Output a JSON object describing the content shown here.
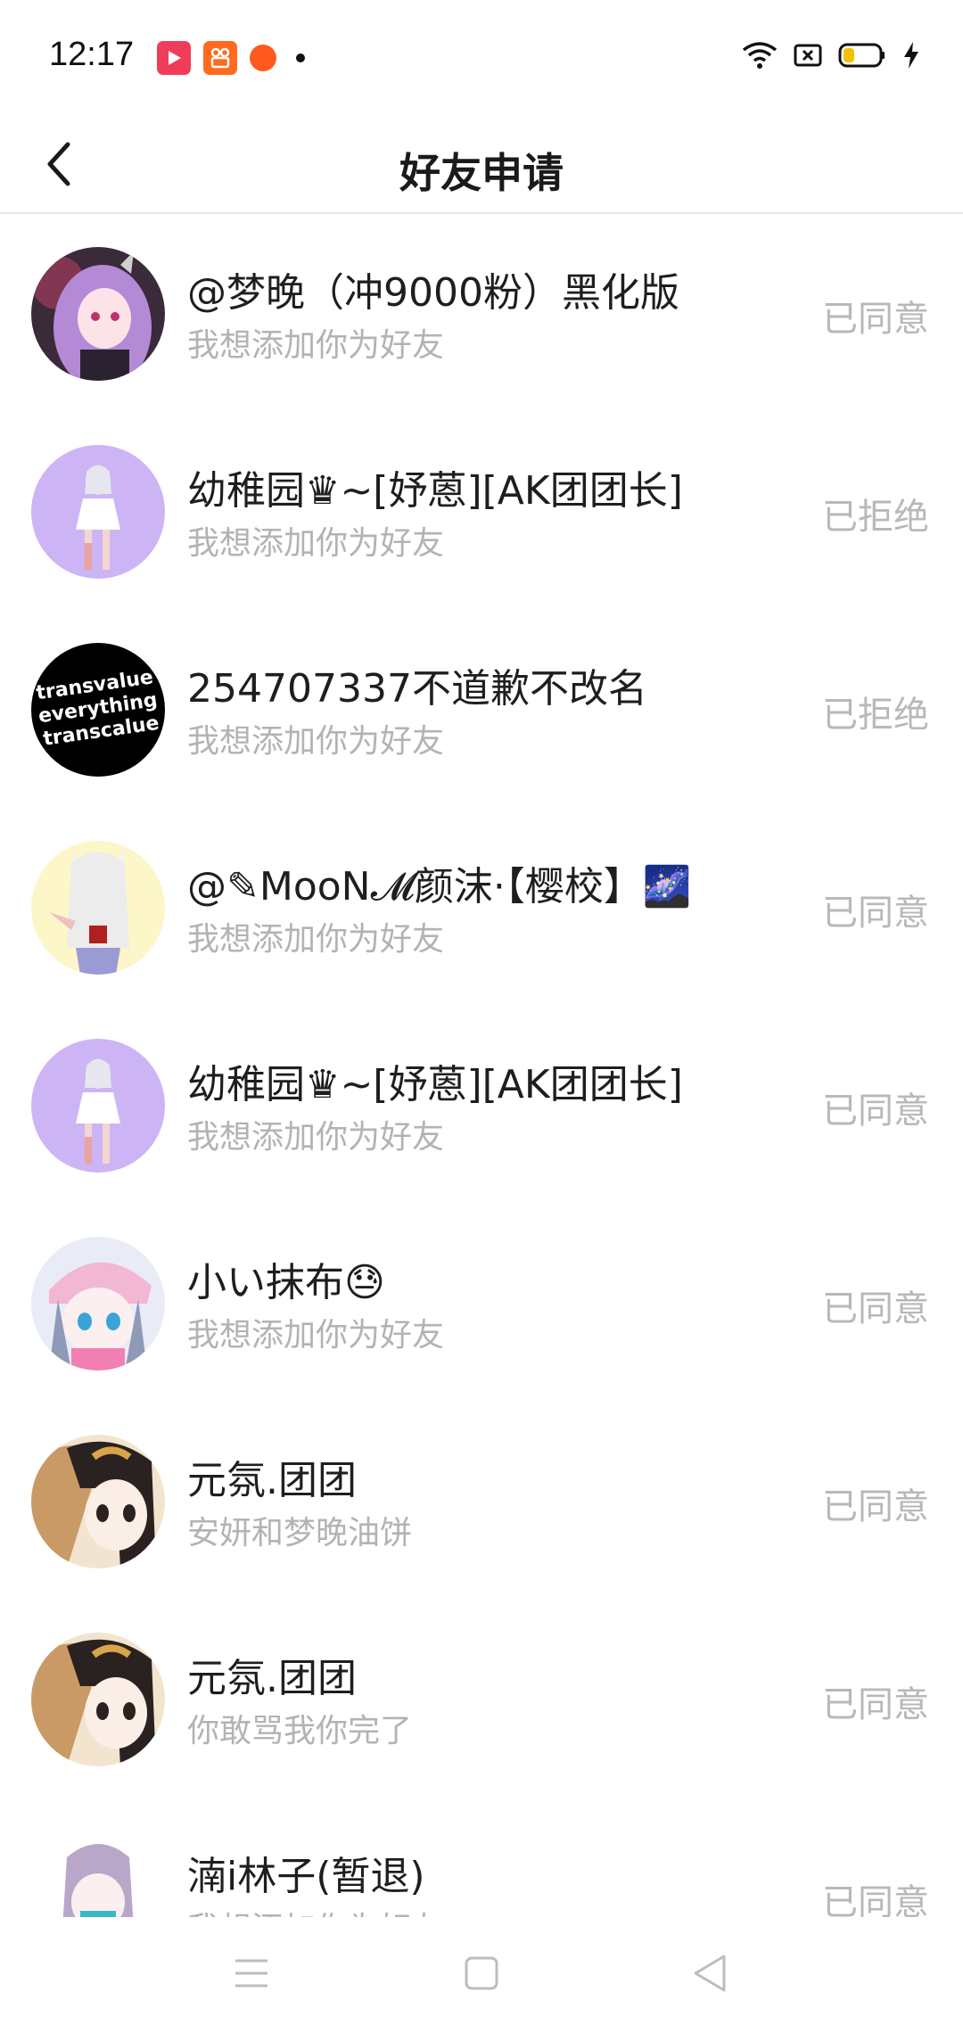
{
  "status_bar": {
    "time": "12:17",
    "apps": [
      "video-app-icon",
      "kuaishou-icon",
      "weibo-icon"
    ],
    "right_icons": [
      "wifi-icon",
      "no-sim-icon",
      "battery-icon",
      "charging-icon"
    ]
  },
  "header": {
    "title": "好友申请",
    "back_icon": "chevron-left-icon"
  },
  "requests": [
    {
      "name": "@梦晚（冲9000粉）黑化版",
      "message": "我想添加你为好友",
      "status": "已同意",
      "avatar": "anime-girl-purple-hair"
    },
    {
      "name": "幼稚园♛~[妤蒽][AK团团长]",
      "message": "我想添加你为好友",
      "status": "已拒绝",
      "avatar": "anime-girl-lavender"
    },
    {
      "name": "254707337不道歉不改名",
      "message": "我想添加你为好友",
      "status": "已拒绝",
      "avatar": "text-logo-black",
      "avatar_text": [
        "transvalue",
        "everything",
        "transcalue"
      ]
    },
    {
      "name": "@✎MooN𝓜颜沫·【樱校】🌌",
      "message": "我想添加你为好友",
      "status": "已同意",
      "avatar": "anime-cat-girl-yellow"
    },
    {
      "name": "幼稚园♛~[妤蒽][AK团团长]",
      "message": "我想添加你为好友",
      "status": "已同意",
      "avatar": "anime-girl-lavender"
    },
    {
      "name": "小い抹布😓",
      "message": "我想添加你为好友",
      "status": "已同意",
      "avatar": "anime-girl-pink-cap"
    },
    {
      "name": "元氛.团团",
      "message": "安妍和梦晚油饼",
      "status": "已同意",
      "avatar": "anime-girl-dark-hair"
    },
    {
      "name": "元氛.团团",
      "message": "你敢骂我你完了",
      "status": "已同意",
      "avatar": "anime-girl-dark-hair"
    },
    {
      "name": "湳i林子(暂退)",
      "message": "我想添加你为好友",
      "status": "已同意",
      "avatar": "anime-girl-silver-hair"
    }
  ],
  "navbar": {
    "items": [
      "menu-icon",
      "home-square-icon",
      "back-triangle-icon"
    ]
  }
}
